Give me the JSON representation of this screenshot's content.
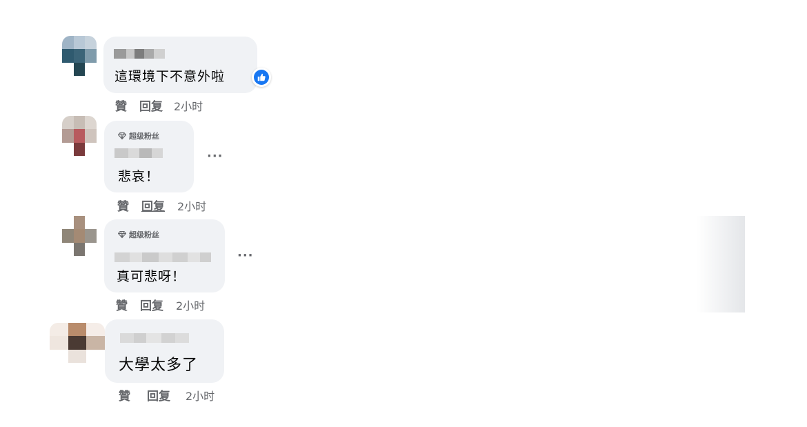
{
  "comments": [
    {
      "text": "這環境下不意外啦",
      "actions": {
        "like": "贊",
        "reply": "回复",
        "time": "2小时"
      },
      "has_reaction": true,
      "reaction_icon": "thumbs-up-icon"
    },
    {
      "badge": "超级粉丝",
      "text": "悲哀！",
      "actions": {
        "like": "贊",
        "reply": "回复",
        "time": "2小时"
      },
      "more": "···"
    },
    {
      "badge": "超级粉丝",
      "text": "真可悲呀！",
      "actions": {
        "like": "贊",
        "reply": "回复",
        "time": "2小时"
      },
      "more": "···"
    },
    {
      "text": "大學太多了",
      "actions": {
        "like": "贊",
        "reply": "回复",
        "time": "2小时"
      }
    }
  ],
  "colors": {
    "bubble": "#f0f2f5",
    "secondary_text": "#65676b",
    "accent": "#1877f2"
  }
}
